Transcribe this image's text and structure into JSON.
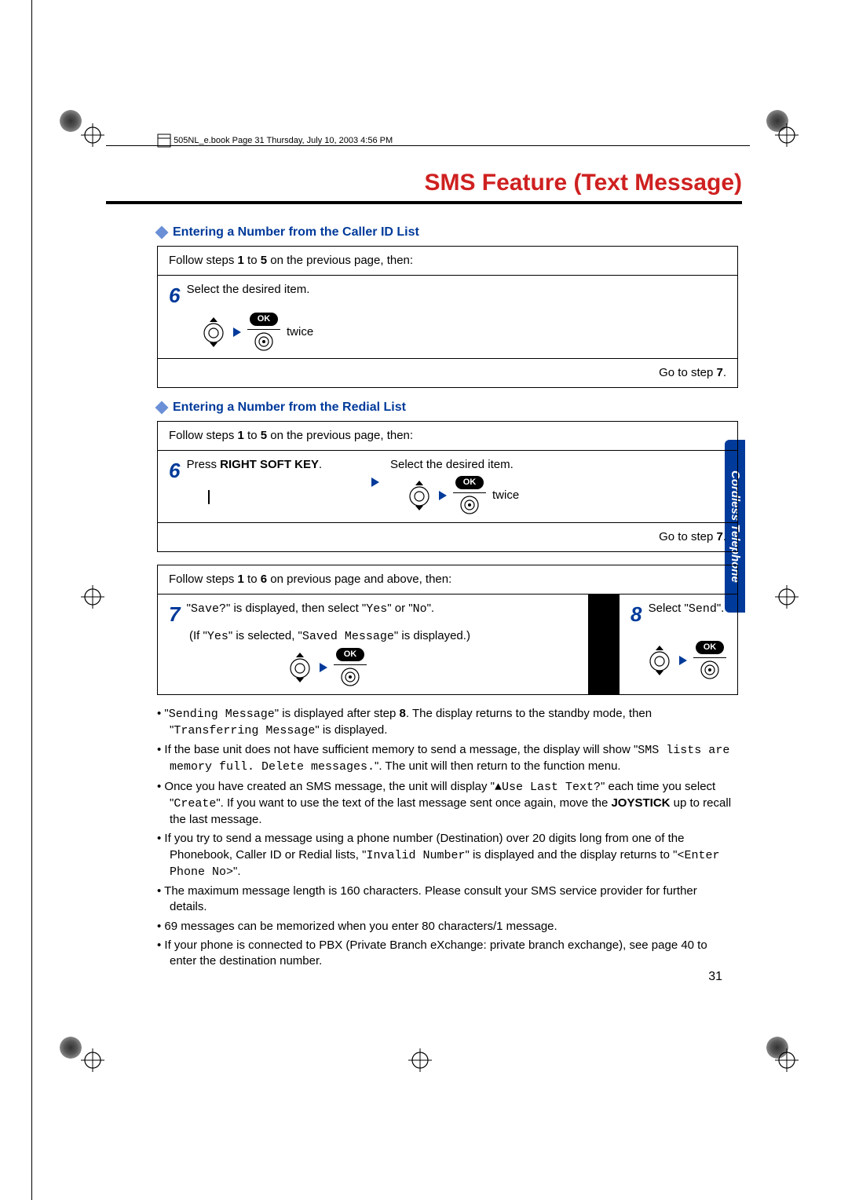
{
  "header_note": "505NL_e.book  Page 31  Thursday, July 10, 2003  4:56 PM",
  "title": "SMS Feature (Text Message)",
  "side_tab": "Cordless Telephone",
  "page_number": "31",
  "section1": {
    "heading": "Entering a Number from the Caller ID List",
    "intro_a": "Follow steps ",
    "intro_b": "1",
    "intro_c": " to ",
    "intro_d": "5",
    "intro_e": " on the previous page, then:",
    "step6_num": "6",
    "step6_text": "Select the desired item.",
    "twice": "twice",
    "go": "Go to step ",
    "go_num": "7",
    "go_end": "."
  },
  "section2": {
    "heading": "Entering a Number from the Redial List",
    "intro_a": "Follow steps ",
    "intro_b": "1",
    "intro_c": " to ",
    "intro_d": "5",
    "intro_e": " on the previous page, then:",
    "step6_num": "6",
    "step6_text_a": "Press ",
    "step6_text_b": "RIGHT SOFT KEY",
    "step6_text_c": ".",
    "step6_right": "Select the desired item.",
    "twice": "twice",
    "go": "Go to step ",
    "go_num": "7",
    "go_end": "."
  },
  "section3": {
    "intro_a": "Follow steps ",
    "intro_b": "1",
    "intro_c": " to ",
    "intro_d": "6",
    "intro_e": " on previous page and above, then:",
    "step7_num": "7",
    "step7_a": "\"",
    "step7_b": "Save?",
    "step7_c": "\" is displayed, then select \"",
    "step7_d": "Yes",
    "step7_e": "\" or \"",
    "step7_f": "No",
    "step7_g": "\".",
    "step7_sub_a": "(If \"",
    "step7_sub_b": "Yes",
    "step7_sub_c": "\" is selected, \"",
    "step7_sub_d": "Saved Message",
    "step7_sub_e": "\" is displayed.)",
    "step8_num": "8",
    "step8_a": "Select \"",
    "step8_b": "Send",
    "step8_c": "\"."
  },
  "bullets": {
    "b1_a": "\"",
    "b1_b": "Sending Message",
    "b1_c": "\" is displayed after step ",
    "b1_d": "8",
    "b1_e": ". The display returns to the standby mode, then \"",
    "b1_f": "Transferring Message",
    "b1_g": "\" is displayed.",
    "b2_a": "If the base unit does not have sufficient memory to send a message, the display will show \"",
    "b2_b": "SMS lists are memory full. Delete messages.",
    "b2_c": "\". The unit will then return to the function menu.",
    "b3_a": "Once you have created an SMS message, the unit will display \"",
    "b3_b": "▲Use Last Text?",
    "b3_c": "\" each time you select \"",
    "b3_d": "Create",
    "b3_e": "\". If you want to use the text of the last message sent once again, move the ",
    "b3_f": "JOYSTICK",
    "b3_g": " up to recall the last message.",
    "b4_a": "If you try to send a message using a phone number (Destination) over 20 digits long from one of the Phonebook, Caller ID or Redial lists, \"",
    "b4_b": "Invalid Number",
    "b4_c": "\" is displayed and the display returns to \"",
    "b4_d": "<Enter Phone No>",
    "b4_e": "\".",
    "b5": "The maximum message length is 160 characters. Please consult your SMS service provider for further details.",
    "b6": "69 messages can be memorized when you enter 80 characters/1 message.",
    "b7": "If your phone is connected to PBX (Private Branch eXchange: private branch exchange), see page 40 to enter the destination number."
  },
  "ok_label": "OK"
}
